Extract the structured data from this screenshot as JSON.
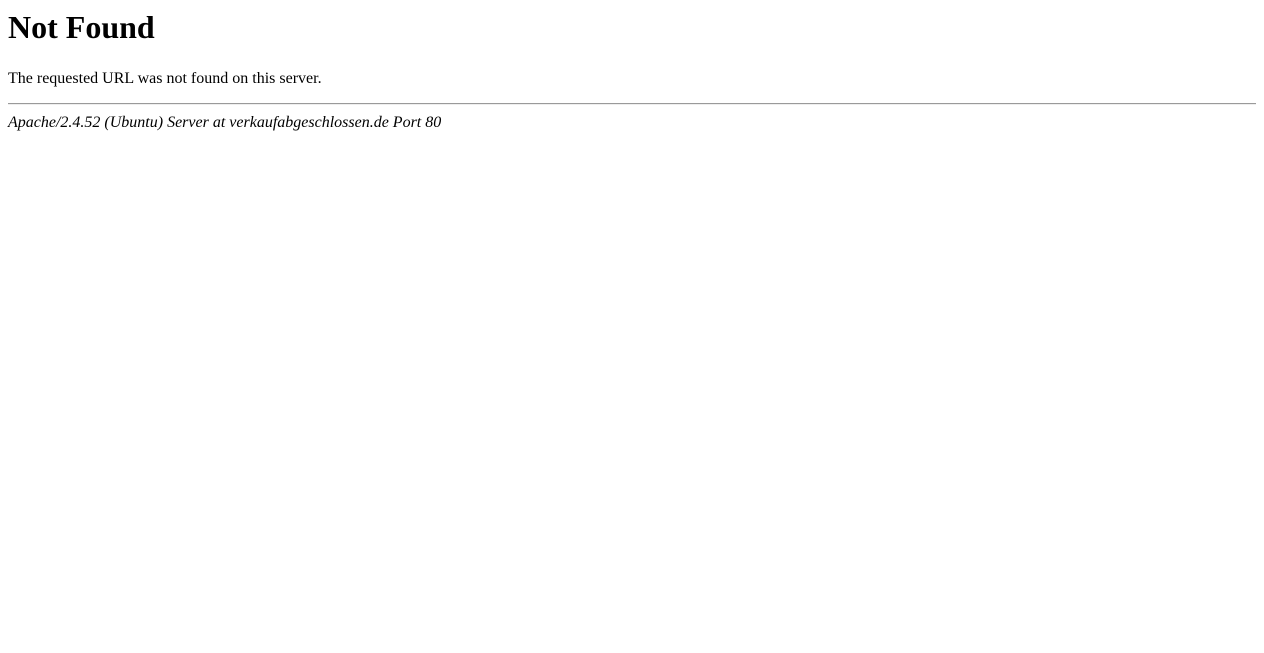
{
  "page": {
    "heading": "Not Found",
    "message": "The requested URL was not found on this server.",
    "server_signature": "Apache/2.4.52 (Ubuntu) Server at verkaufabgeschlossen.de Port 80"
  }
}
